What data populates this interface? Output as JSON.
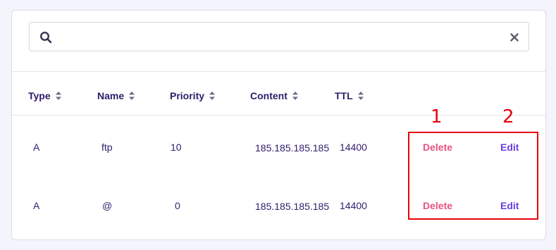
{
  "search": {
    "value": "",
    "placeholder": ""
  },
  "table": {
    "columns": [
      {
        "label": "Type"
      },
      {
        "label": "Name"
      },
      {
        "label": "Priority"
      },
      {
        "label": "Content"
      },
      {
        "label": "TTL"
      }
    ],
    "rows": [
      {
        "type": "A",
        "name": "ftp",
        "priority": "10",
        "content": "185.185.185.185",
        "ttl": "14400",
        "delete_label": "Delete",
        "edit_label": "Edit"
      },
      {
        "type": "A",
        "name": "@",
        "priority": "0",
        "content": "185.185.185.185",
        "ttl": "14400",
        "delete_label": "Delete",
        "edit_label": "Edit"
      }
    ]
  },
  "annotations": {
    "marker_1": "1",
    "marker_2": "2"
  },
  "colors": {
    "heading": "#2f1c6a",
    "delete": "#e8527f",
    "edit": "#673de6",
    "annotation": "#e8000b"
  },
  "icons": {
    "search": "search-icon",
    "clear": "close-icon",
    "sort": "sort-icon"
  }
}
